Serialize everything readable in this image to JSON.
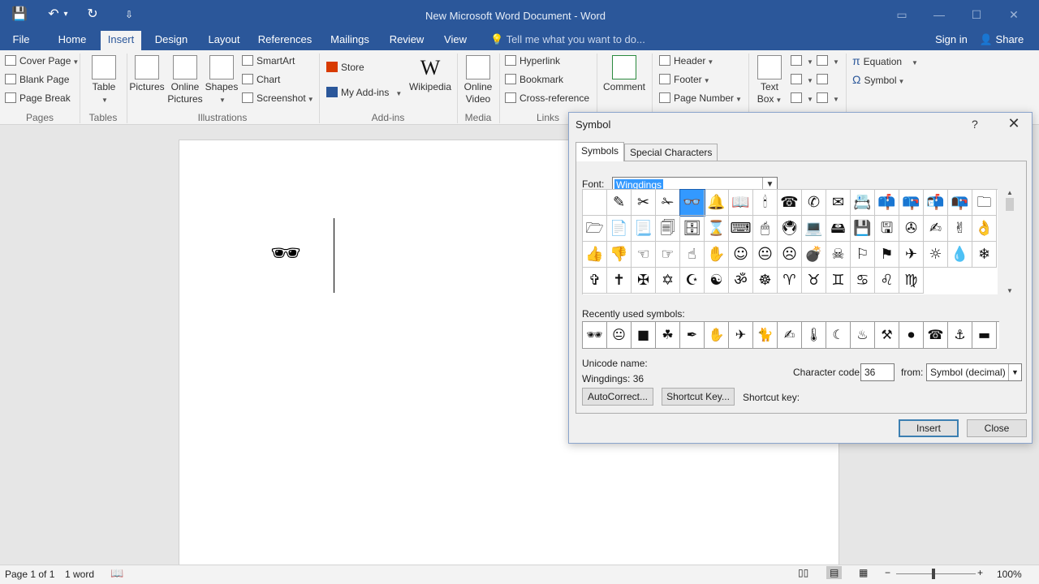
{
  "titlebar": {
    "title": "New Microsoft Word Document - Word",
    "save_icon": "💾",
    "undo_icon": "↶",
    "redo_icon": "↻",
    "customize_icon": "⇩",
    "undo_dd": "▾",
    "min": "—",
    "max": "☐",
    "close": "✕",
    "options": "▭"
  },
  "tabs": {
    "file": "File",
    "home": "Home",
    "insert": "Insert",
    "design": "Design",
    "layout": "Layout",
    "references": "References",
    "mailings": "Mailings",
    "review": "Review",
    "view": "View",
    "tellme": "Tell me what you want to do...",
    "signin": "Sign in",
    "share": "Share"
  },
  "ribbon": {
    "pages": {
      "cover": "Cover Page",
      "blank": "Blank Page",
      "break": "Page Break",
      "group": "Pages"
    },
    "tables": {
      "table": "Table",
      "group": "Tables"
    },
    "illus": {
      "pictures": "Pictures",
      "online1": "Online",
      "online2": "Pictures",
      "shapes": "Shapes",
      "smartart": "SmartArt",
      "chart": "Chart",
      "screenshot": "Screenshot",
      "group": "Illustrations"
    },
    "addins": {
      "store": "Store",
      "myaddins": "My Add-ins",
      "wikipedia": "Wikipedia",
      "wiki_logo": "W",
      "group": "Add-ins"
    },
    "media": {
      "video1": "Online",
      "video2": "Video",
      "group": "Media"
    },
    "links": {
      "hyperlink": "Hyperlink",
      "bookmark": "Bookmark",
      "crossref": "Cross-reference",
      "group": "Links"
    },
    "comments": {
      "comment": "Comment"
    },
    "hf": {
      "header": "Header",
      "footer": "Footer",
      "pagenum": "Page Number"
    },
    "text": {
      "tb1": "Text",
      "tb2": "Box"
    },
    "symbols": {
      "equation": "Equation",
      "equation_glyph": "π",
      "symbol": "Symbol",
      "symbol_glyph": "Ω"
    }
  },
  "document": {
    "content": "🕶"
  },
  "status": {
    "page": "Page 1 of 1",
    "words": "1 word",
    "zoom": "100%"
  },
  "dialog": {
    "title": "Symbol",
    "help": "?",
    "close_glyph": "✕",
    "tab_symbols": "Symbols",
    "tab_special": "Special Characters",
    "font_label": "Font:",
    "font_value": "Wingdings",
    "grid_symbols": [
      "",
      "✎",
      "✂",
      "✁",
      "👓",
      "🔔",
      "📖",
      "🕯",
      "☎",
      "✆",
      "✉",
      "📇",
      "📫",
      "📪",
      "📬",
      "📭",
      "🗀",
      "🗁",
      "📄",
      "📃",
      "🗐",
      "🗄",
      "⌛",
      "⌨",
      "🖱",
      "🖲",
      "💻",
      "🖴",
      "💾",
      "🖫",
      "✇",
      "✍",
      "✌",
      "👌",
      "👍",
      "👎",
      "☜",
      "☞",
      "☝",
      "✋",
      "☺",
      "😐",
      "☹",
      "💣",
      "☠",
      "⚐",
      "⚑",
      "✈",
      "☼",
      "💧",
      "❄",
      "✞",
      "✝",
      "✠",
      "✡",
      "☪",
      "☯",
      "ॐ",
      "☸",
      "♈",
      "♉",
      "♊",
      "♋",
      "♌",
      "♍"
    ],
    "recent_label": "Recently used symbols:",
    "recent_symbols": [
      "🕶",
      "😐",
      "■",
      "☘",
      "✒",
      "✋",
      "✈",
      "🐈",
      "✍",
      "🌡",
      "☾",
      "♨",
      "⚒",
      "⏺",
      "☎",
      "⚓",
      "▬"
    ],
    "unicode_label": "Unicode name:",
    "unicode_value": "Wingdings: 36",
    "charcode_label": "Character code:",
    "charcode_value": "36",
    "from_label": "from:",
    "from_value": "Symbol (decimal)",
    "autocorrect": "AutoCorrect...",
    "shortcut": "Shortcut Key...",
    "shortcut_label": "Shortcut key:",
    "insert": "Insert",
    "close": "Close"
  }
}
